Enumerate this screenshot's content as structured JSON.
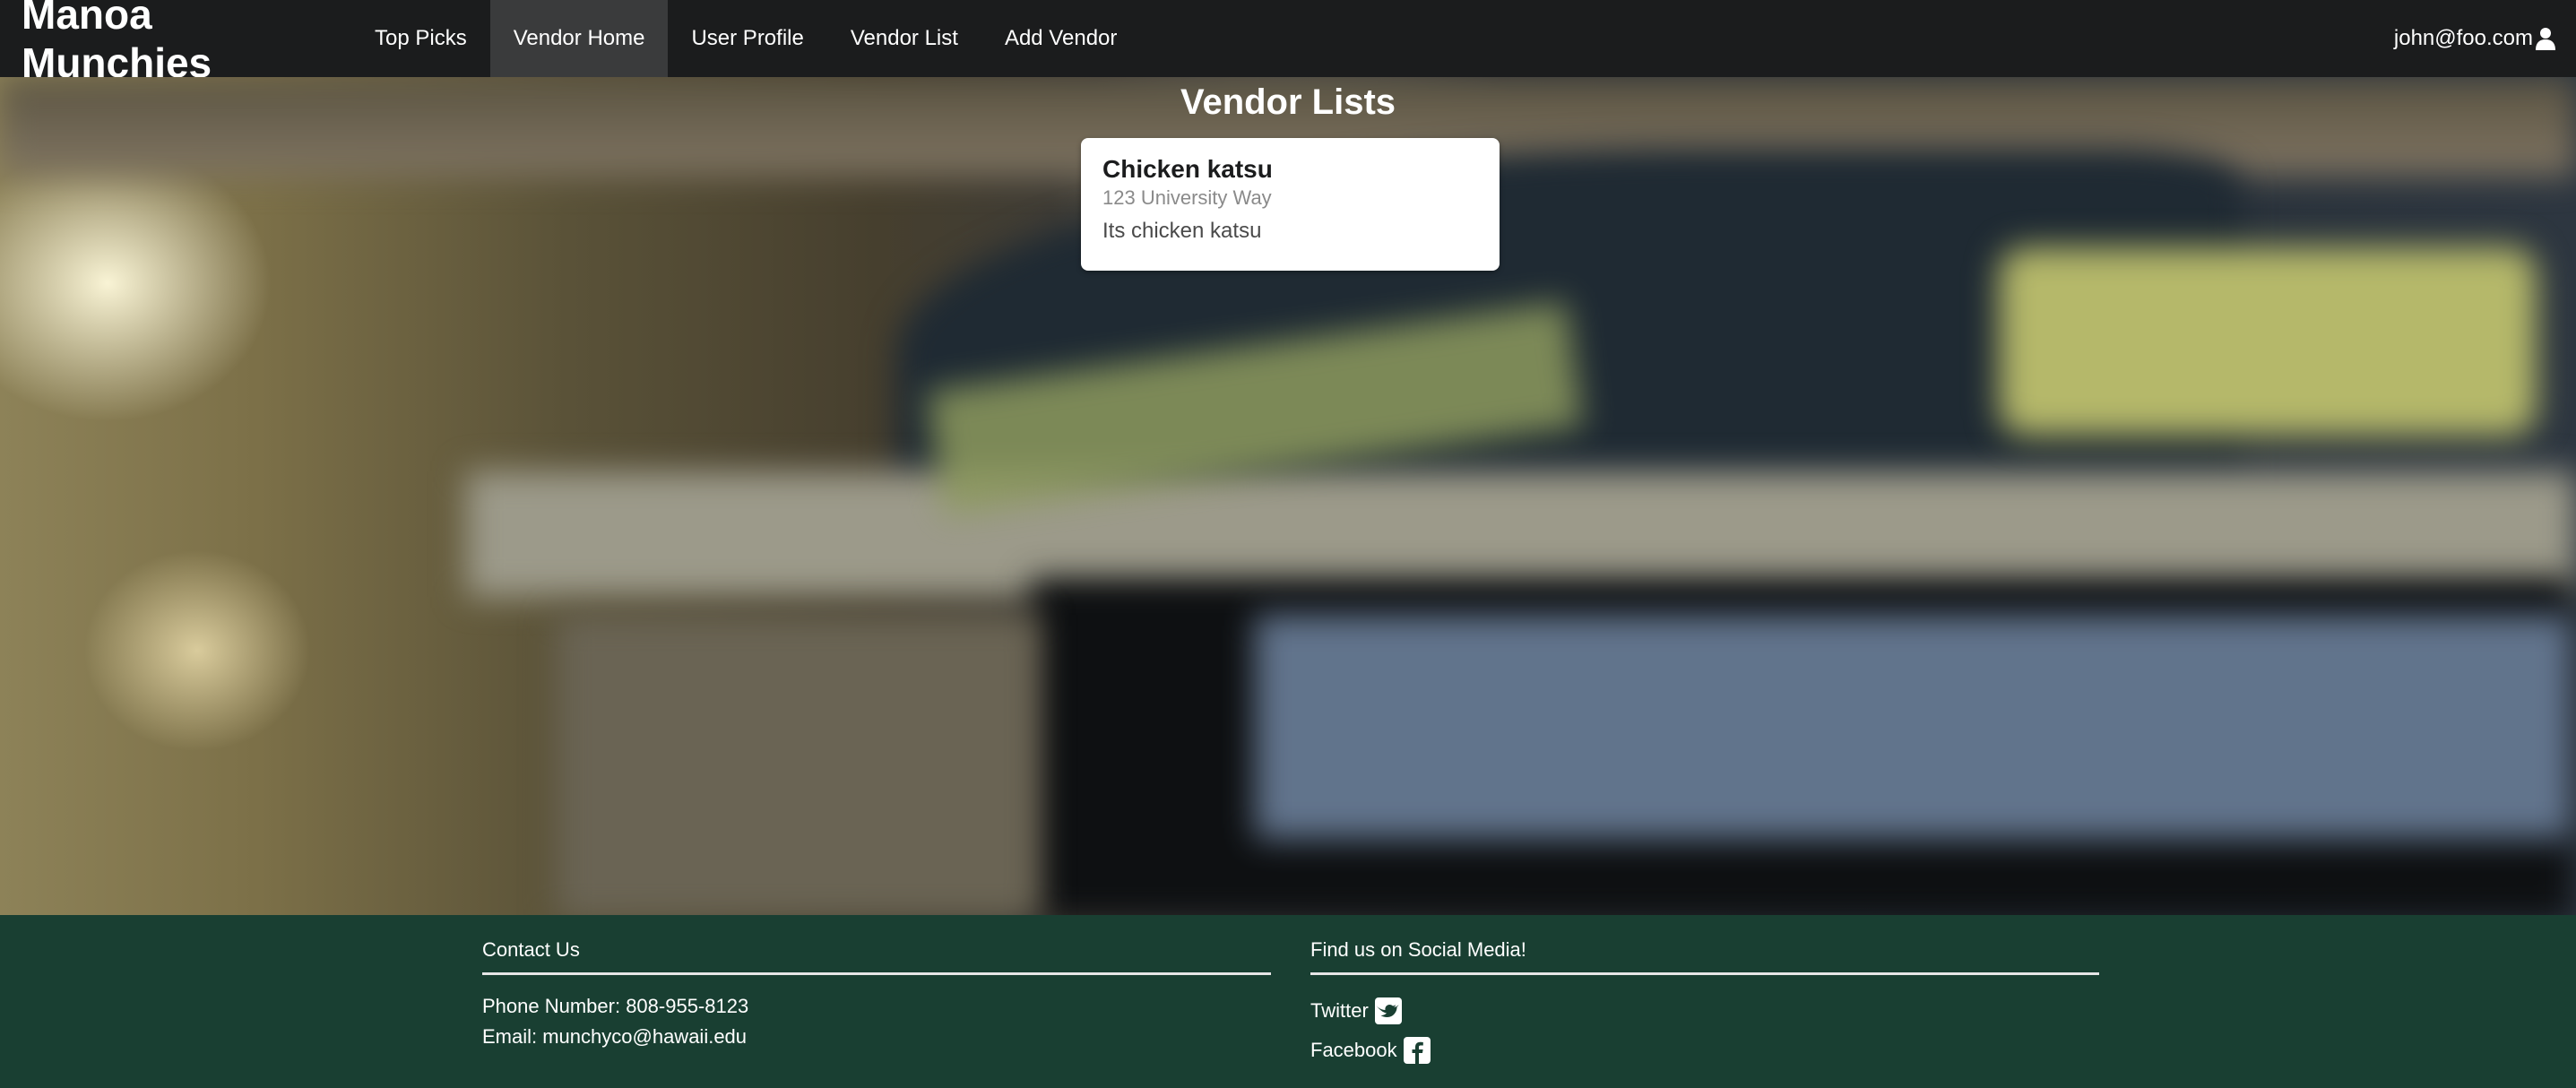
{
  "navbar": {
    "brand": "Manoa Munchies",
    "items": [
      {
        "label": "Top Picks",
        "active": false
      },
      {
        "label": "Vendor Home",
        "active": true
      },
      {
        "label": "User Profile",
        "active": false
      },
      {
        "label": "Vendor List",
        "active": false
      },
      {
        "label": "Add Vendor",
        "active": false
      }
    ],
    "user": {
      "email": "john@foo.com",
      "icon": "user-icon"
    }
  },
  "main": {
    "title": "Vendor Lists",
    "cards": [
      {
        "title": "Chicken katsu",
        "address": "123 University Way",
        "description": "Its chicken katsu"
      }
    ]
  },
  "footer": {
    "contact": {
      "heading": "Contact Us",
      "phone": "Phone Number: 808-955-8123",
      "email": "Email: munchyco@hawaii.edu"
    },
    "social": {
      "heading": "Find us on Social Media!",
      "links": [
        {
          "label": "Twitter",
          "icon": "twitter-icon"
        },
        {
          "label": "Facebook",
          "icon": "facebook-icon"
        }
      ]
    }
  },
  "colors": {
    "navbar_bg": "#1b1c1d",
    "active_item_bg": "#3a3b3c",
    "footer_bg": "#193f32"
  }
}
